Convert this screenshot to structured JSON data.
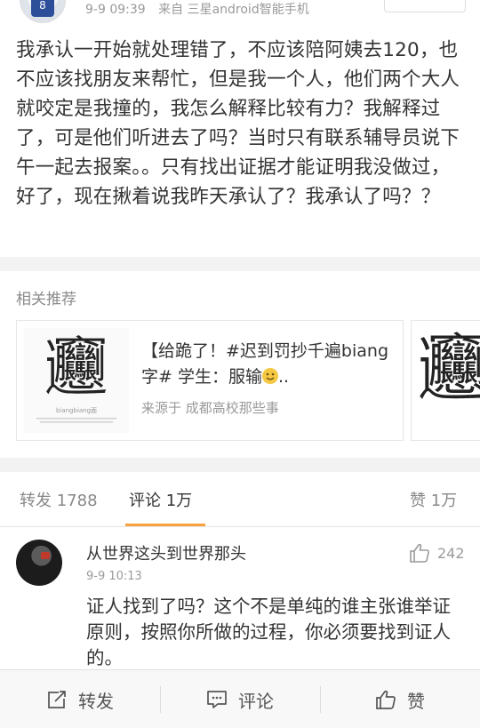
{
  "post": {
    "meta_time": "9-9 09:39",
    "meta_source": "来自 三星android智能手机",
    "text": "我承认一开始就处理错了，不应该陪阿姨去120，也不应该找朋友来帮忙，但是我一个人，他们两个大人就咬定是我撞的，我怎么解释比较有力？我解释过了，可是他们听进去了吗？当时只有联系辅导员说下午一起去报案。。只有找出证据才能证明我没做过，好了，现在揪着说我昨天承认了？我承认了吗？？"
  },
  "related": {
    "title": "相关推荐",
    "card": {
      "thumb_glyph": "𰻞",
      "thumb_caption": "biangbiang面",
      "title": "【给跪了！#迟到罚抄千遍biang字# 学生：服输",
      "title_suffix": "..",
      "source": "来源于 成都高校那些事"
    },
    "card2": {
      "thumb_glyph": "𰻞"
    }
  },
  "tabs": {
    "repost": "转发 1788",
    "comment": "评论 1万",
    "like": "赞 1万"
  },
  "comment": {
    "username": "从世界这头到世界那头",
    "time": "9-9 10:13",
    "likes": "242",
    "text": "证人找到了吗？这个不是单纯的谁主张谁举证原则，按照你所做的过程，你必须要找到证人的。"
  },
  "bottom_bar": {
    "repost": "转发",
    "comment": "评论",
    "like": "赞"
  },
  "colors": {
    "accent": "#f7a23c",
    "text": "#333333",
    "muted": "#9a9a9a"
  },
  "icons": [
    "share-icon",
    "comment-icon",
    "thumbs-up-icon"
  ]
}
